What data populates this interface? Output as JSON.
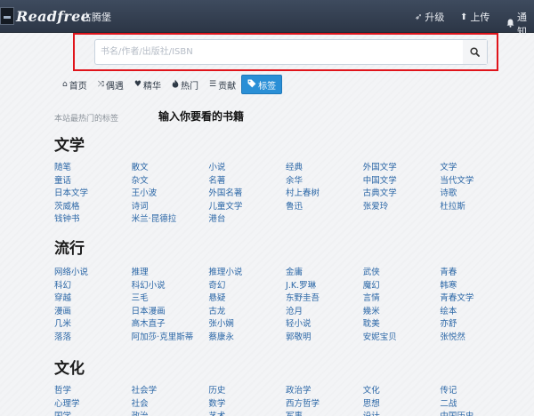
{
  "navbar": {
    "brand": "Readfree",
    "left_link": "古腾堡",
    "right": [
      {
        "icon": "rocket-icon",
        "glyph": "➶",
        "label": "升级"
      },
      {
        "icon": "upload-icon",
        "glyph": "⬆",
        "label": "上传"
      },
      {
        "icon": "bell-icon",
        "glyph": "🔔",
        "label": "通知"
      }
    ]
  },
  "search": {
    "placeholder": "书名/作者/出版社/ISBN",
    "value": "",
    "button_icon": "search-icon"
  },
  "tabs": [
    {
      "icon": "home-icon",
      "glyph": "⌂",
      "label": "首页",
      "active": false
    },
    {
      "icon": "shuffle-icon",
      "glyph": "⤨",
      "label": "偶遇",
      "active": false
    },
    {
      "icon": "heart-icon",
      "glyph": "♥",
      "label": "精华",
      "active": false
    },
    {
      "icon": "fire-icon",
      "glyph": "🔥",
      "label": "热门",
      "active": false
    },
    {
      "icon": "list-icon",
      "glyph": "☰",
      "label": "贡献",
      "active": false
    },
    {
      "icon": "tags-icon",
      "glyph": "🏷",
      "label": "标签",
      "active": true
    }
  ],
  "content": {
    "hint": "本站最热门的标签",
    "lead": "输入你要看的书籍"
  },
  "sections": [
    {
      "title": "文学",
      "rows": [
        [
          "随笔",
          "散文",
          "小说",
          "经典",
          "外国文学",
          "文学"
        ],
        [
          "童话",
          "杂文",
          "名著",
          "余华",
          "中国文学",
          "当代文学"
        ],
        [
          "日本文学",
          "王小波",
          "外国名著",
          "村上春树",
          "古典文学",
          "诗歌"
        ],
        [
          "茨威格",
          "诗词",
          "儿童文学",
          "鲁迅",
          "张爱玲",
          "杜拉斯"
        ],
        [
          "钱钟书",
          "米兰·昆德拉",
          "港台",
          "",
          "",
          ""
        ]
      ]
    },
    {
      "title": "流行",
      "rows": [
        [
          "网络小说",
          "推理",
          "推理小说",
          "金庸",
          "武侠",
          "青春"
        ],
        [
          "科幻",
          "科幻小说",
          "奇幻",
          "J.K.罗琳",
          "魔幻",
          "韩寒"
        ],
        [
          "穿越",
          "三毛",
          "悬疑",
          "东野圭吾",
          "言情",
          "青春文学"
        ],
        [
          "漫画",
          "日本漫画",
          "古龙",
          "沧月",
          "幾米",
          "绘本"
        ],
        [
          "几米",
          "高木直子",
          "张小娴",
          "轻小说",
          "耽美",
          "亦舒"
        ],
        [
          "落落",
          "阿加莎·克里斯蒂",
          "蔡康永",
          "郭敬明",
          "安妮宝贝",
          "张悦然"
        ]
      ]
    },
    {
      "title": "文化",
      "rows": [
        [
          "哲学",
          "社会学",
          "历史",
          "政治学",
          "文化",
          "传记"
        ],
        [
          "心理学",
          "社会",
          "数学",
          "西方哲学",
          "思想",
          "二战"
        ],
        [
          "国学",
          "政治",
          "艺术",
          "军事",
          "设计",
          "中国历史"
        ]
      ]
    }
  ],
  "colors": {
    "navbar": "#2f3a4a",
    "link": "#2a66a6",
    "active_tab": "#2a8fd6",
    "highlight_frame": "#e0141b"
  }
}
